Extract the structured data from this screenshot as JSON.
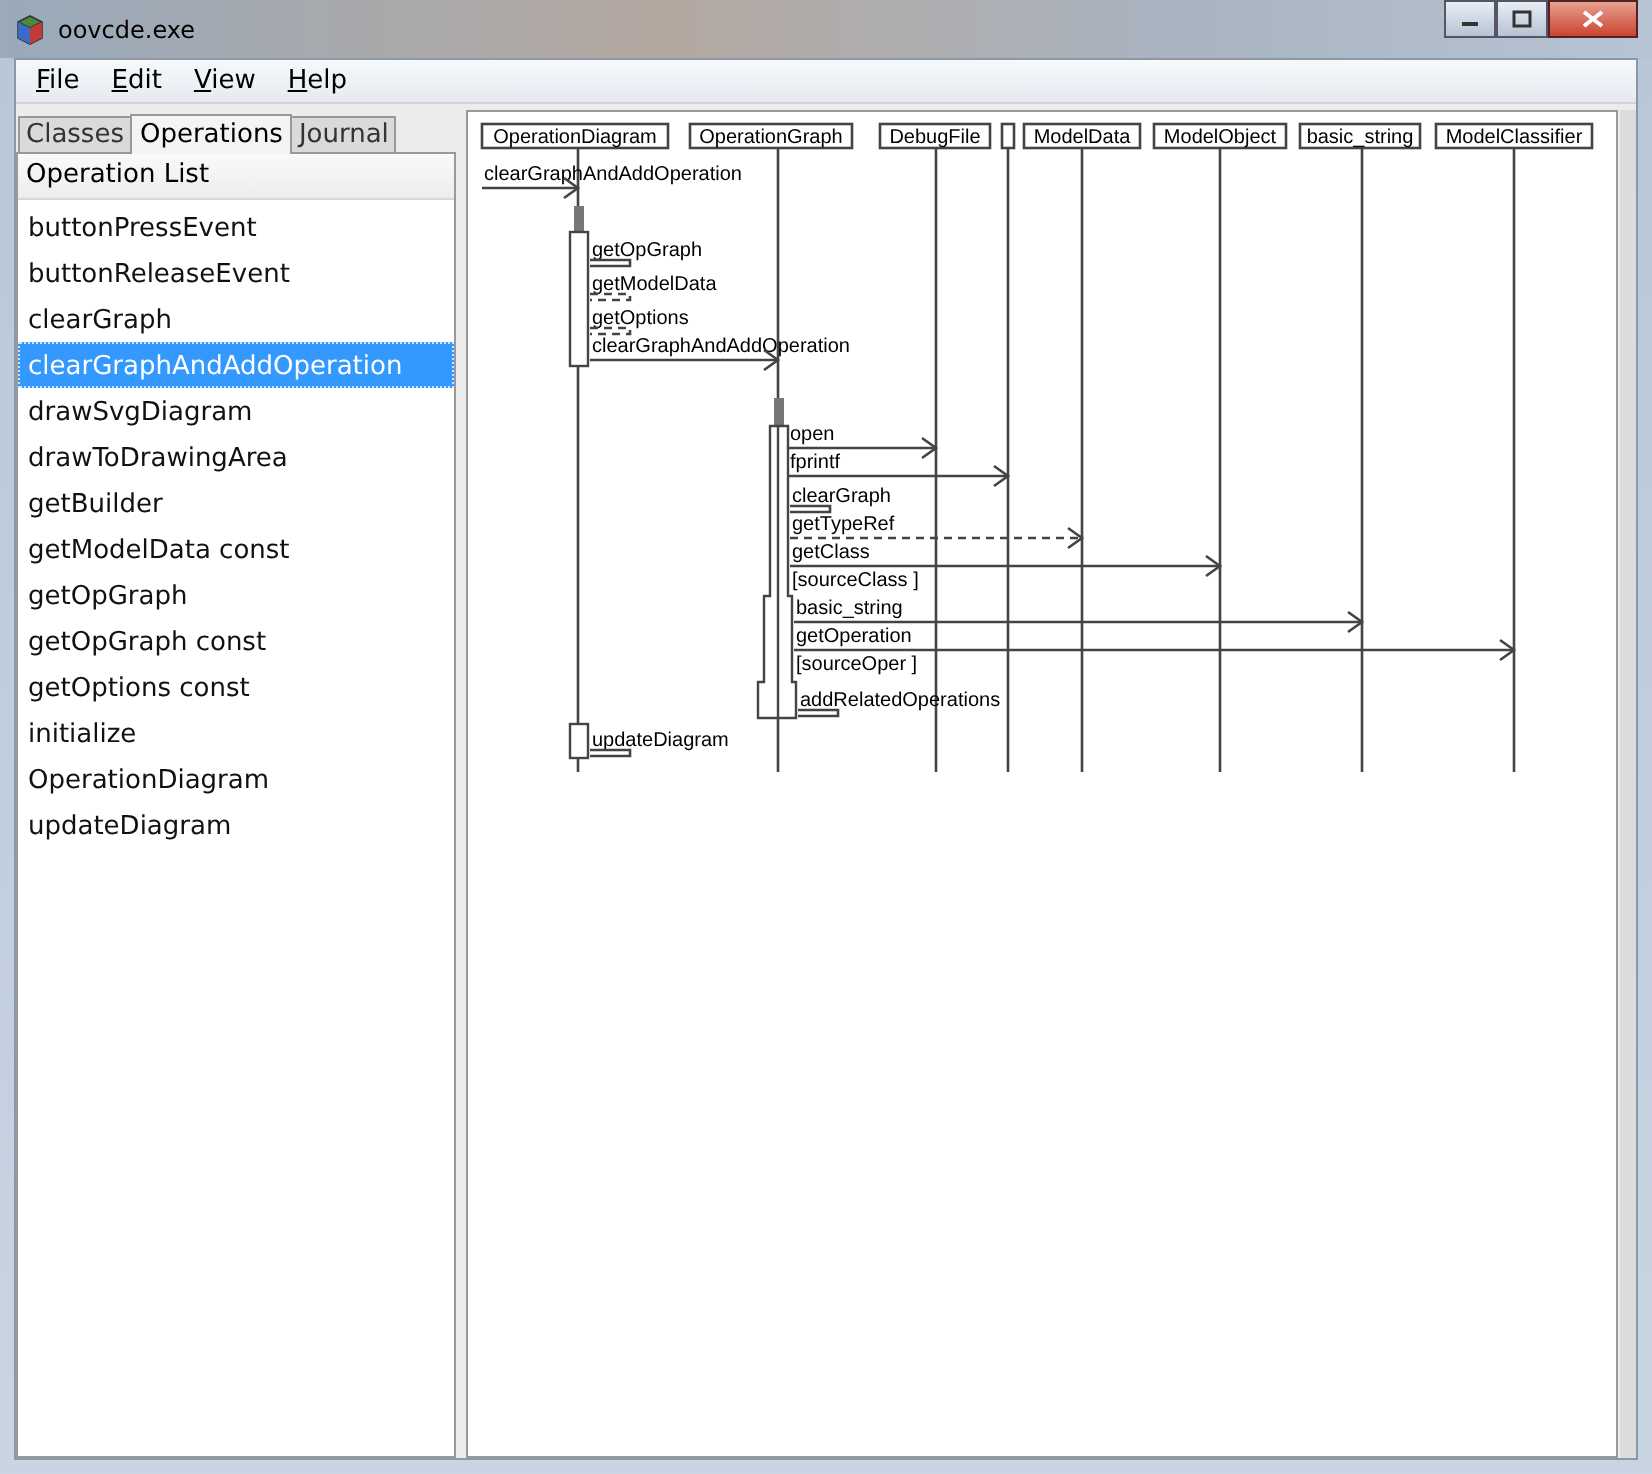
{
  "window": {
    "title": "oovcde.exe"
  },
  "menu": [
    {
      "label": "File"
    },
    {
      "label": "Edit"
    },
    {
      "label": "View"
    },
    {
      "label": "Help"
    }
  ],
  "tabs": [
    {
      "label": "Classes",
      "selected": false
    },
    {
      "label": "Operations",
      "selected": true
    },
    {
      "label": "Journal",
      "selected": false
    }
  ],
  "operation_list": {
    "header": "Operation List",
    "items": [
      {
        "label": "buttonPressEvent",
        "selected": false
      },
      {
        "label": "buttonReleaseEvent",
        "selected": false
      },
      {
        "label": "clearGraph",
        "selected": false
      },
      {
        "label": "clearGraphAndAddOperation",
        "selected": true
      },
      {
        "label": "drawSvgDiagram",
        "selected": false
      },
      {
        "label": "drawToDrawingArea",
        "selected": false
      },
      {
        "label": "getBuilder",
        "selected": false
      },
      {
        "label": "getModelData const",
        "selected": false
      },
      {
        "label": "getOpGraph",
        "selected": false
      },
      {
        "label": "getOpGraph const",
        "selected": false
      },
      {
        "label": "getOptions const",
        "selected": false
      },
      {
        "label": "initialize",
        "selected": false
      },
      {
        "label": "OperationDiagram",
        "selected": false
      },
      {
        "label": "updateDiagram",
        "selected": false
      }
    ]
  },
  "diagram": {
    "lifelines": [
      {
        "kind": "named",
        "name": "OperationDiagram"
      },
      {
        "kind": "named",
        "name": "OperationGraph"
      },
      {
        "kind": "named",
        "name": "DebugFile"
      },
      {
        "kind": "unnamed"
      },
      {
        "kind": "named",
        "name": "ModelData"
      },
      {
        "kind": "named",
        "name": "ModelObject"
      },
      {
        "kind": "named",
        "name": "basic_string"
      },
      {
        "kind": "named",
        "name": "ModelClassifier"
      }
    ],
    "messages": [
      {
        "kind": "found",
        "label": "clearGraphAndAddOperation"
      },
      {
        "kind": "self",
        "label": "getOpGraph"
      },
      {
        "kind": "self_dashed",
        "label": "getModelData"
      },
      {
        "kind": "self_dashed",
        "label": "getOptions"
      },
      {
        "kind": "call",
        "label": "clearGraphAndAddOperation"
      },
      {
        "kind": "call",
        "label": "open"
      },
      {
        "kind": "call",
        "label": "fprintf"
      },
      {
        "kind": "self",
        "label": "clearGraph"
      },
      {
        "kind": "dashed",
        "label": "getTypeRef"
      },
      {
        "kind": "call",
        "label": "getClass"
      },
      {
        "kind": "guard",
        "label": "[sourceClass ]"
      },
      {
        "kind": "call",
        "label": "basic_string"
      },
      {
        "kind": "call",
        "label": "getOperation"
      },
      {
        "kind": "guard",
        "label": "[sourceOper ]"
      },
      {
        "kind": "self",
        "label": "addRelatedOperations"
      },
      {
        "kind": "self",
        "label": "updateDiagram"
      }
    ]
  }
}
